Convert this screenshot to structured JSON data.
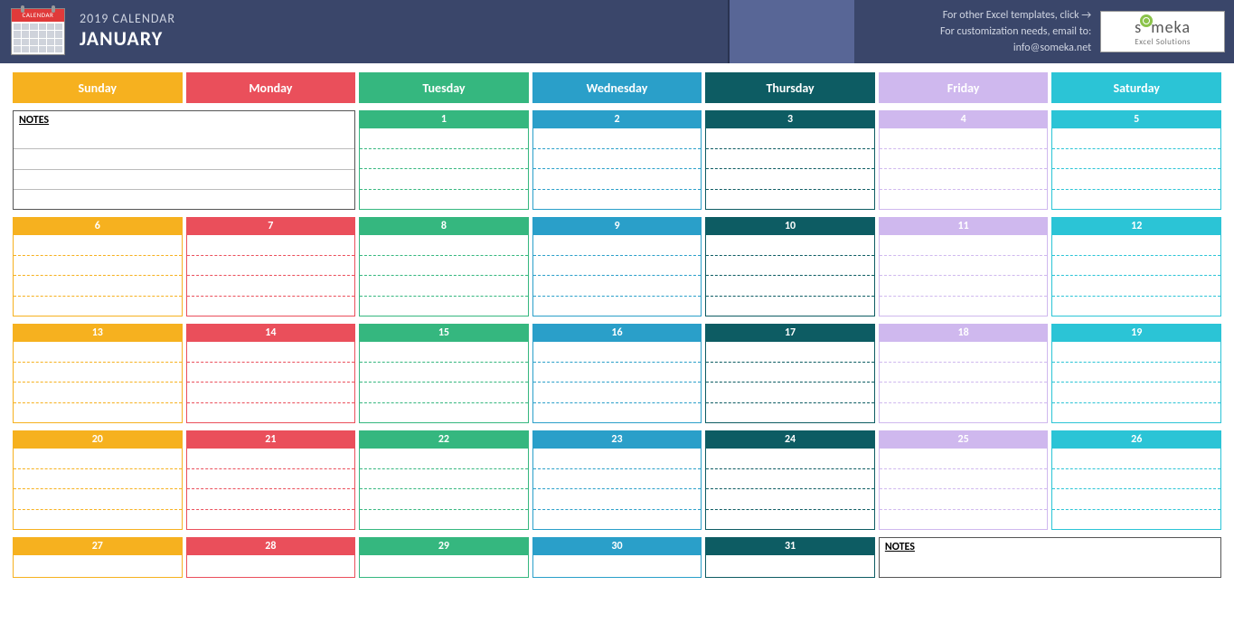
{
  "header": {
    "icon_label": "CALENDAR",
    "year_label": "2019 CALENDAR",
    "month": "JANUARY",
    "templates_text": "For other Excel templates, click →",
    "customization_text": "For customization needs, email to: info@someka.net",
    "logo_main_left": "s",
    "logo_main_right": "meka",
    "logo_sub": "Excel Solutions"
  },
  "days": {
    "sun": "Sunday",
    "mon": "Monday",
    "tue": "Tuesday",
    "wed": "Wednesday",
    "thu": "Thursday",
    "fri": "Friday",
    "sat": "Saturday"
  },
  "notes_label": "NOTES",
  "weeks": [
    {
      "cells": [
        "",
        "",
        "1",
        "2",
        "3",
        "4",
        "5"
      ],
      "notes_start": true
    },
    {
      "cells": [
        "6",
        "7",
        "8",
        "9",
        "10",
        "11",
        "12"
      ]
    },
    {
      "cells": [
        "13",
        "14",
        "15",
        "16",
        "17",
        "18",
        "19"
      ]
    },
    {
      "cells": [
        "20",
        "21",
        "22",
        "23",
        "24",
        "25",
        "26"
      ]
    },
    {
      "cells": [
        "27",
        "28",
        "29",
        "30",
        "31",
        "",
        ""
      ],
      "notes_end": true
    }
  ],
  "colors": {
    "sun": "#f6b11f",
    "mon": "#ea4f5b",
    "tue": "#35b77f",
    "wed": "#2a9fc9",
    "thu": "#0d5c63",
    "fri": "#cfb8ee",
    "sat": "#2bc4d6"
  }
}
